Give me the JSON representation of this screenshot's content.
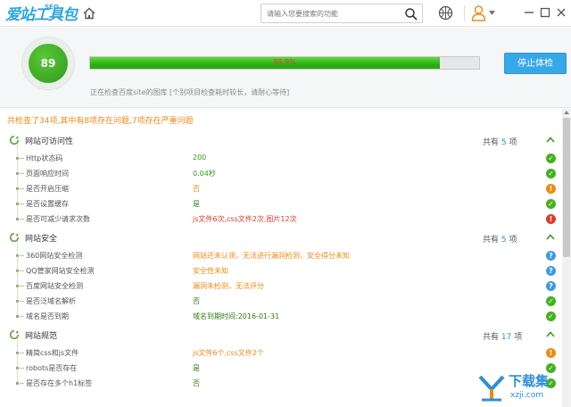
{
  "app": {
    "logo_text": "爱站工具包",
    "logo_badge": "SEO"
  },
  "search": {
    "placeholder": "请输入您要搜索的功能"
  },
  "header": {
    "score": "89",
    "progress_percent": 89.9,
    "progress_label": "89.9%",
    "status": "正在检查百度site的图库 [个别项目检查耗时较长，请耐心等待]",
    "stop_button": "停止体检"
  },
  "summary": "共检查了34项,其中有8项存在问题,7项存在严重问题",
  "sections": [
    {
      "title": "网站可访问性",
      "count_prefix": "共有",
      "count": "5",
      "count_suffix": "项",
      "rows": [
        {
          "label": "Http状态码",
          "value": "200",
          "value_color": "green",
          "status": "ok"
        },
        {
          "label": "页面响应时间",
          "value": "0.04秒",
          "value_color": "green",
          "status": "ok"
        },
        {
          "label": "是否开启压缩",
          "value": "否",
          "value_color": "orange",
          "status": "warn"
        },
        {
          "label": "是否设置缓存",
          "value": "是",
          "value_color": "dark",
          "status": "ok"
        },
        {
          "label": "是否可减少请求次数",
          "value": "js文件6次,css文件2次,图片12次",
          "value_color": "red",
          "status": "err"
        }
      ]
    },
    {
      "title": "网站安全",
      "count_prefix": "共有",
      "count": "5",
      "count_suffix": "项",
      "rows": [
        {
          "label": "360网站安全检测",
          "value": "网站还未认领，无法进行漏洞检测，安全得分未知",
          "value_color": "orange",
          "status": "info"
        },
        {
          "label": "QQ管家网站安全检测",
          "value": "安全性未知",
          "value_color": "orange",
          "status": "info"
        },
        {
          "label": "百度网站安全检测",
          "value": "漏洞未检测，无法评分",
          "value_color": "orange",
          "status": "info"
        },
        {
          "label": "是否泛域名解析",
          "value": "否",
          "value_color": "dark",
          "status": "ok"
        },
        {
          "label": "域名是否到期",
          "value": "域名到期时间:2016-01-31",
          "value_color": "dark",
          "status": "ok"
        }
      ]
    },
    {
      "title": "网站规范",
      "count_prefix": "共有",
      "count": "17",
      "count_suffix": "项",
      "rows": [
        {
          "label": "精简css和js文件",
          "value": "js文件6个,css文件2个",
          "value_color": "orange",
          "status": "warn"
        },
        {
          "label": "robots是否存在",
          "value": "是",
          "value_color": "dark",
          "status": "ok"
        },
        {
          "label": "是否存在多个h1标签",
          "value": "否",
          "value_color": "dark",
          "status": "ok"
        }
      ]
    }
  ],
  "status_glyphs": {
    "ok": "✓",
    "warn": "!",
    "err": "!",
    "info": "?"
  },
  "watermark": {
    "text": "下载集",
    "sub": "xzji.com"
  },
  "colors": {
    "accent": "#36a8e6",
    "ok": "#43b21e",
    "warn": "#f08a12",
    "err": "#e03b2c",
    "info": "#3c9ae0"
  }
}
